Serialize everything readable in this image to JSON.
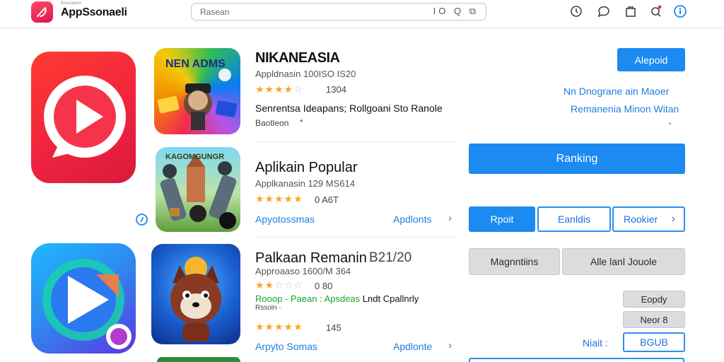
{
  "header": {
    "brand_small": "Boosaenn",
    "brand": "AppSsonaeli",
    "search_placeholder": "Rasean",
    "search_icons": "IO Q ⧉"
  },
  "apps": [
    {
      "thumb_caption": "NEN ADMS",
      "title": "NIKANEASIA",
      "meta": "Appldnasin 100ISO IS20",
      "stars": "★★★★",
      "stars_off": "☆",
      "rating": "1304",
      "desc": "Senrentsa Ideapans; Rollgoani Sto Ranole",
      "sub": "Baotleon"
    },
    {
      "thumb_caption": "KAGOMGUNGR",
      "title": "Aplikain Popular",
      "meta": "Applkanasin 129 MS614",
      "stars": "★★★★★",
      "rating": "0 A6T",
      "link_left": "Apyotossmas",
      "link_right": "Apdlonts"
    },
    {
      "title": "Palkaan Remanin",
      "title_extra": "B21/20",
      "meta": "Approaaso 1600/M 364",
      "stars": "★★",
      "stars_off": "☆☆☆",
      "rating": "0  80",
      "green_line": "Rooop - Paean : Apsdeas",
      "green_line_black": "Lndt Cpallnrly",
      "sub": "Rssoin ·",
      "stars2": "★★★★★",
      "rating2": "145",
      "link_left": "Arpyto Somas",
      "link_right": "Apdlonte"
    }
  ],
  "right_panel": {
    "report_button": "Alepoid",
    "note_line1": "Nn Dnograne ain Maoer",
    "note_line2": "Remanenia Minon Witan",
    "ranking_button": "Ranking",
    "tab_report": "Rpoit",
    "tab_eanlds": "Eanldis",
    "tab_rookier": "Rookier",
    "grey_left": "Magnntiins",
    "grey_right": "Alle lanl Jouole",
    "small_btn1": "Eopdy",
    "small_btn2": "Neor 8",
    "visit_label": "Niait :",
    "visit_button": "BGUB"
  }
}
